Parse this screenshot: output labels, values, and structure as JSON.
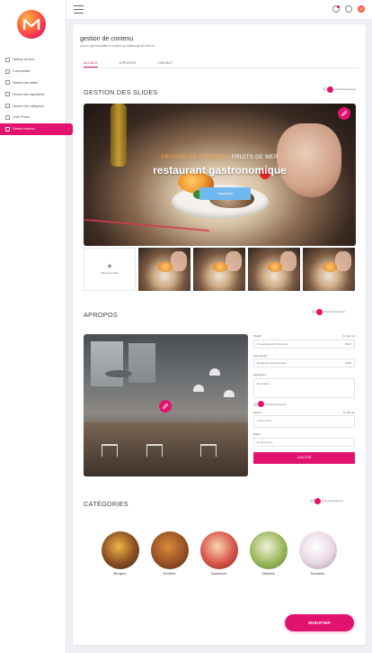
{
  "sidebar": {
    "items": [
      {
        "label": "Tableau de bord",
        "icon": "dashboard-icon"
      },
      {
        "label": "Commandes",
        "icon": "cart-icon"
      },
      {
        "label": "Gestion des tables",
        "icon": "table-icon"
      },
      {
        "label": "Gestion des ingrédients",
        "icon": "ingredients-icon"
      },
      {
        "label": "Gestion des catégories",
        "icon": "category-icon"
      },
      {
        "label": "Code Promo",
        "icon": "promo-icon"
      },
      {
        "label": "Gestion contenu",
        "icon": "content-icon",
        "active": true
      }
    ]
  },
  "page": {
    "title": "gestion de contenu",
    "subtitle": "vous'ez gérer/modifier le contenu du tableau genel des/vos"
  },
  "tabs": [
    {
      "label": "ACCUEIL",
      "active": true
    },
    {
      "label": "A PROPOS",
      "active": false
    },
    {
      "label": "CONTACT",
      "active": false
    }
  ],
  "slides": {
    "title": "GESTION DES SLIDES",
    "toggle_label": "Activer/Désactiver",
    "hero_tag_1": "FRITURE DE POISSON",
    "hero_tag_2": "- FRUITS DE MER",
    "hero_title": "restaurant gastronomique",
    "hero_button": "Commander",
    "add_label": "Nouveau slide"
  },
  "about": {
    "title": "APROPOS",
    "toggle_label": "Activer/Désactiver",
    "title_label": "Titre(fr)",
    "title_lang": "Fr | En | Ar",
    "title_value": "Friendshaker du Patissonne",
    "title_count": "35/35",
    "subtitle_label": "Sous-titre(fr)",
    "subtitle_value": "Restaurant gastronomique",
    "subtitle_count": "24/50",
    "description_label": "description",
    "description_value": "Description",
    "toggle2_label": "Activer/Désactiver",
    "section_label": "Section",
    "section_lang": "Fr | En | Ar",
    "section_value": "Lorem ipsum",
    "button_label": "Button",
    "button_value": "En savoir plus",
    "add_button": "AJOUTER"
  },
  "categories": {
    "title": "CATÉGORIES",
    "toggle_label": "Activer/Désactiver",
    "items": [
      {
        "label": "Burgers",
        "colors": [
          "#f0b54a",
          "#8a4e22",
          "#3b2314"
        ]
      },
      {
        "label": "Entrées",
        "colors": [
          "#d98a3c",
          "#9a5226",
          "#4a2a18"
        ]
      },
      {
        "label": "Sandwich",
        "colors": [
          "#f7d7b0",
          "#d9554a",
          "#7a2c24"
        ]
      },
      {
        "label": "Salades",
        "colors": [
          "#f2f0dc",
          "#9ab85a",
          "#5c7a34"
        ]
      },
      {
        "label": "Desserts",
        "colors": [
          "#ffffff",
          "#e9d8e4",
          "#a8889a"
        ]
      }
    ]
  },
  "footer": {
    "save_button": "MODIFIER"
  },
  "colors": {
    "accent": "#e2136e",
    "button_blue": "#6fb8f0"
  }
}
